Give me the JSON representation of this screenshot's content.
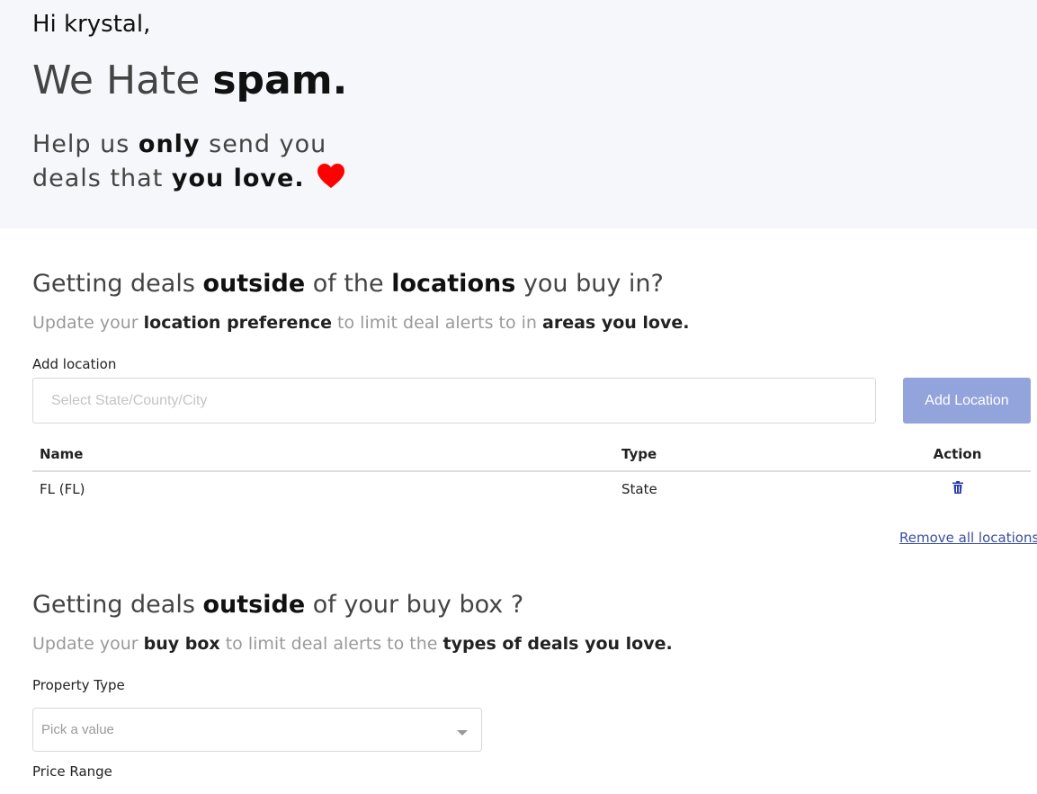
{
  "hero": {
    "greeting": "Hi krystal,",
    "headline_plain": "We Hate ",
    "headline_bold": "spam.",
    "tagline_1": "Help us ",
    "tagline_2": "only",
    "tagline_3": " send you",
    "tagline_4": "deals that ",
    "tagline_5": "you love.",
    "heart_icon": "heart-icon",
    "heart_color": "#ff0000"
  },
  "locations": {
    "title_1": "Getting deals ",
    "title_2": "outside",
    "title_3": " of the ",
    "title_4": "locations",
    "title_5": " you buy in?",
    "sub_1": "Update your ",
    "sub_2": "location preference",
    "sub_3": " to limit deal alerts to in ",
    "sub_4": "areas you love.",
    "add_label": "Add location",
    "input_placeholder": "Select State/County/City",
    "add_button": "Add Location",
    "button_color": "#93a3dc",
    "columns": {
      "name": "Name",
      "type": "Type",
      "action": "Action"
    },
    "rows": [
      {
        "name": "FL (FL)",
        "type": "State",
        "action_icon": "trash-icon"
      }
    ],
    "remove_all": "Remove all locations"
  },
  "buybox": {
    "title_1": "Getting deals ",
    "title_2": "outside",
    "title_3": " of your buy box ?",
    "sub_1": "Update your ",
    "sub_2": "buy box",
    "sub_3": " to limit deal alerts to the ",
    "sub_4": "types of deals you love.",
    "property_type_label": "Property Type",
    "property_type_value": "Pick a value",
    "price_range_label": "Price Range"
  }
}
